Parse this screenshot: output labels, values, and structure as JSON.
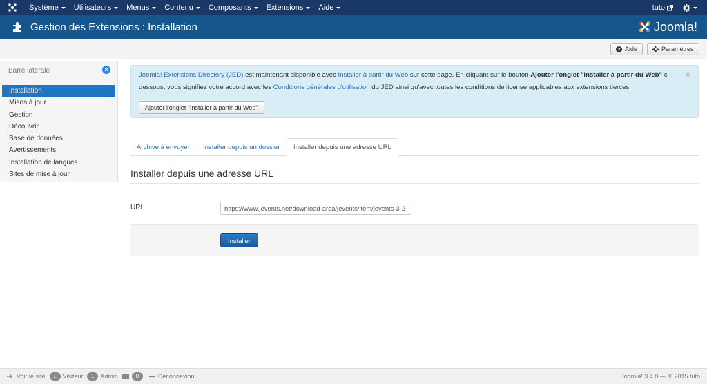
{
  "topnav": {
    "menu": [
      {
        "label": "Système"
      },
      {
        "label": "Utilisateurs"
      },
      {
        "label": "Menus"
      },
      {
        "label": "Contenu"
      },
      {
        "label": "Composants"
      },
      {
        "label": "Extensions"
      },
      {
        "label": "Aide"
      }
    ],
    "user": "tuto"
  },
  "header": {
    "title": "Gestion des Extensions : Installation",
    "brand": "Joomla!"
  },
  "toolbar": {
    "help_label": "Aide",
    "options_label": "Paramètres"
  },
  "sidebar": {
    "title": "Barre latérale",
    "items": [
      {
        "label": "Installation",
        "active": true
      },
      {
        "label": "Mises à jour"
      },
      {
        "label": "Gestion"
      },
      {
        "label": "Découvrir"
      },
      {
        "label": "Base de données"
      },
      {
        "label": "Avertissements"
      },
      {
        "label": "Installation de langues"
      },
      {
        "label": "Sites de mise à jour"
      }
    ]
  },
  "alert": {
    "link1": "Joomla! Extensions Directory (JED)",
    "text1": " est maintenant disponible avec ",
    "link2": "Installer à partir du Web",
    "text2": " sur cette page.  En cliquant sur le bouton ",
    "bold": "Ajouter l'onglet \"Installer à partir du Web\"",
    "text3": " ci-dessous, vous signifiez votre accord avec les ",
    "link3": "Conditions générales d'utilisation",
    "text4": " du JED ainsi qu'avec toutes les conditions de license applicables aux extensions tierces.",
    "button": "Ajouter l'onglet \"Installer à partir du Web\"",
    "close": "×"
  },
  "tabs": [
    {
      "label": "Archive à envoyer"
    },
    {
      "label": "Installer depuis un dossier"
    },
    {
      "label": "Installer depuis une adresse URL",
      "active": true
    }
  ],
  "form": {
    "heading": "Installer depuis une adresse URL",
    "url_label": "URL",
    "url_value": "https://www.jevents.net/download-area/jevents/item/jevents-3-2",
    "install_button": "Installer"
  },
  "status": {
    "view_site": "Voir le site",
    "visitors_count": "1",
    "visitors_label": "Visiteur",
    "admin_count": "1",
    "admin_label": "Admin",
    "messages_count": "0",
    "logout": "Déconnexion",
    "version": "Joomla! 3.4.0  —  © 2015 tuto"
  },
  "colors": {
    "navbar": "#1a3867",
    "header": "#17568c",
    "accent": "#2176c3",
    "alert_bg": "#d9edf7"
  }
}
